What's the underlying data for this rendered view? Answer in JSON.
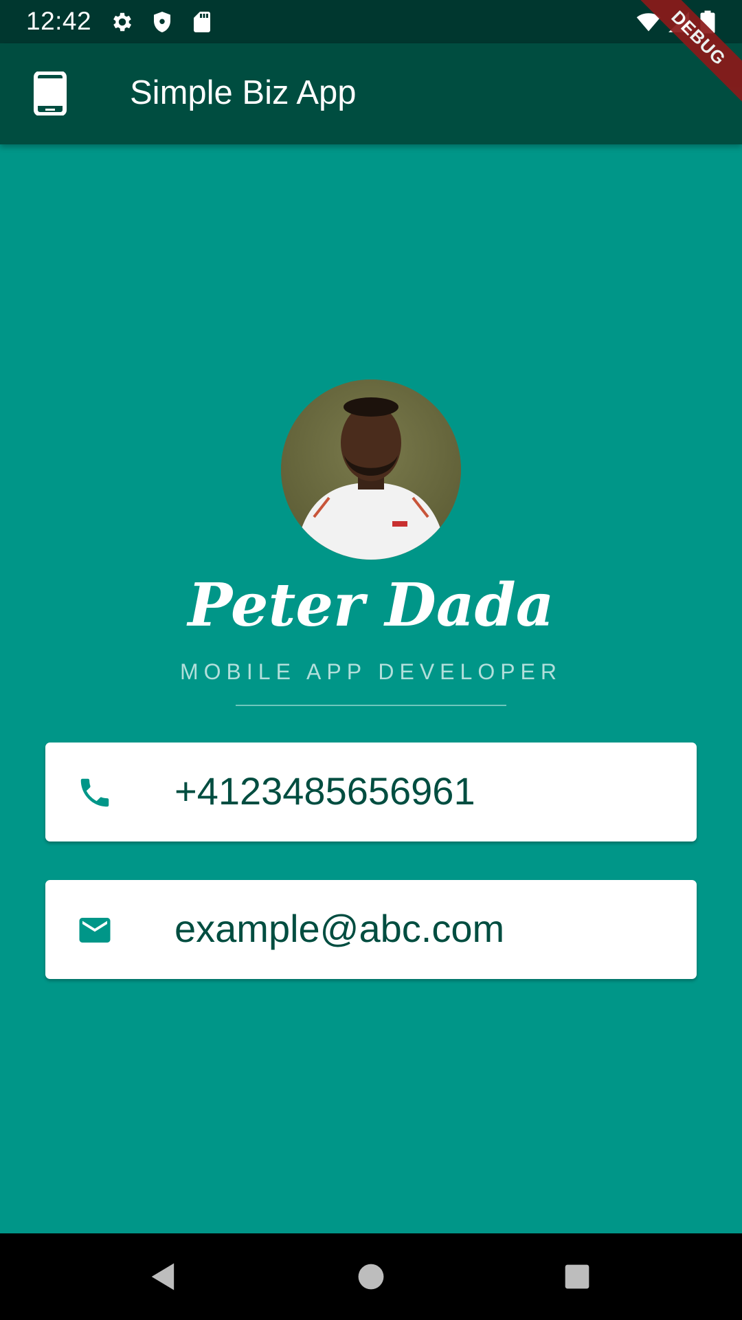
{
  "status_bar": {
    "time": "12:42",
    "icons": [
      "gear-icon",
      "shield-icon",
      "sd-card-icon",
      "wifi-icon",
      "signal-icon",
      "battery-icon"
    ]
  },
  "app_bar": {
    "icon": "smartphone-icon",
    "title": "Simple Biz App"
  },
  "debug_banner": "DEBUG",
  "profile": {
    "name": "Peter Dada",
    "role": "MOBILE APP DEVELOPER"
  },
  "contacts": {
    "phone": {
      "icon": "phone-icon",
      "value": "+4123485656961"
    },
    "email": {
      "icon": "mail-icon",
      "value": "example@abc.com"
    }
  },
  "nav_bar": {
    "buttons": [
      "back-icon",
      "home-icon",
      "recents-icon"
    ]
  },
  "colors": {
    "background": "#009688",
    "app_bar": "#004d40",
    "status_bar": "#00372f",
    "card_text": "#004d40",
    "icon_teal": "#009688",
    "role_text": "#b2dfdb"
  }
}
